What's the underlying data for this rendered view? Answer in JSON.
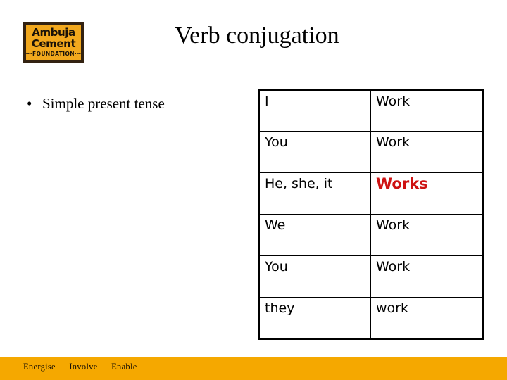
{
  "slide": {
    "title": "Verb conjugation",
    "background_color": "#FFFFFF"
  },
  "logo": {
    "name": "ambuja-cement-foundation-logo",
    "line1": "Ambuja",
    "line2": "Cement",
    "line3": "~·FOUNDATION·~",
    "background_color": "#F2A81D",
    "border_color": "#332211",
    "text_color": "#1A1208"
  },
  "body": {
    "bullets": [
      {
        "marker": "•",
        "text": "Simple present tense"
      }
    ]
  },
  "table": {
    "name": "verb-conjugation-table",
    "columns": [
      "subject",
      "verb"
    ],
    "highlight_color": "#CE1212",
    "rows": [
      {
        "subject": "I",
        "verb": "Work",
        "highlight": false
      },
      {
        "subject": "You",
        "verb": "Work",
        "highlight": false
      },
      {
        "subject": "He, she, it",
        "verb": "Works",
        "highlight": true
      },
      {
        "subject": "We",
        "verb": "Work",
        "highlight": false
      },
      {
        "subject": "You",
        "verb": "Work",
        "highlight": false
      },
      {
        "subject": "they",
        "verb": "work",
        "highlight": false
      }
    ]
  },
  "footer": {
    "background_color": "#F5A800",
    "items": [
      "Energise",
      "Involve",
      "Enable"
    ]
  }
}
